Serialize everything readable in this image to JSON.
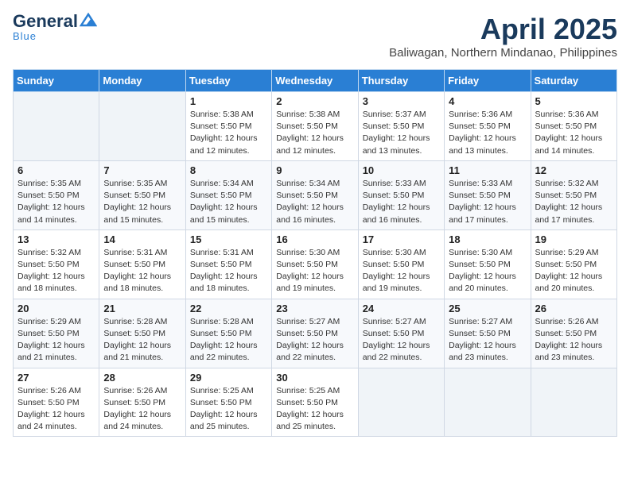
{
  "header": {
    "logo_line1": "General",
    "logo_line2": "Blue",
    "month_year": "April 2025",
    "location": "Baliwagan, Northern Mindanao, Philippines"
  },
  "weekdays": [
    "Sunday",
    "Monday",
    "Tuesday",
    "Wednesday",
    "Thursday",
    "Friday",
    "Saturday"
  ],
  "weeks": [
    [
      {
        "day": "",
        "info": ""
      },
      {
        "day": "",
        "info": ""
      },
      {
        "day": "1",
        "info": "Sunrise: 5:38 AM\nSunset: 5:50 PM\nDaylight: 12 hours and 12 minutes."
      },
      {
        "day": "2",
        "info": "Sunrise: 5:38 AM\nSunset: 5:50 PM\nDaylight: 12 hours and 12 minutes."
      },
      {
        "day": "3",
        "info": "Sunrise: 5:37 AM\nSunset: 5:50 PM\nDaylight: 12 hours and 13 minutes."
      },
      {
        "day": "4",
        "info": "Sunrise: 5:36 AM\nSunset: 5:50 PM\nDaylight: 12 hours and 13 minutes."
      },
      {
        "day": "5",
        "info": "Sunrise: 5:36 AM\nSunset: 5:50 PM\nDaylight: 12 hours and 14 minutes."
      }
    ],
    [
      {
        "day": "6",
        "info": "Sunrise: 5:35 AM\nSunset: 5:50 PM\nDaylight: 12 hours and 14 minutes."
      },
      {
        "day": "7",
        "info": "Sunrise: 5:35 AM\nSunset: 5:50 PM\nDaylight: 12 hours and 15 minutes."
      },
      {
        "day": "8",
        "info": "Sunrise: 5:34 AM\nSunset: 5:50 PM\nDaylight: 12 hours and 15 minutes."
      },
      {
        "day": "9",
        "info": "Sunrise: 5:34 AM\nSunset: 5:50 PM\nDaylight: 12 hours and 16 minutes."
      },
      {
        "day": "10",
        "info": "Sunrise: 5:33 AM\nSunset: 5:50 PM\nDaylight: 12 hours and 16 minutes."
      },
      {
        "day": "11",
        "info": "Sunrise: 5:33 AM\nSunset: 5:50 PM\nDaylight: 12 hours and 17 minutes."
      },
      {
        "day": "12",
        "info": "Sunrise: 5:32 AM\nSunset: 5:50 PM\nDaylight: 12 hours and 17 minutes."
      }
    ],
    [
      {
        "day": "13",
        "info": "Sunrise: 5:32 AM\nSunset: 5:50 PM\nDaylight: 12 hours and 18 minutes."
      },
      {
        "day": "14",
        "info": "Sunrise: 5:31 AM\nSunset: 5:50 PM\nDaylight: 12 hours and 18 minutes."
      },
      {
        "day": "15",
        "info": "Sunrise: 5:31 AM\nSunset: 5:50 PM\nDaylight: 12 hours and 18 minutes."
      },
      {
        "day": "16",
        "info": "Sunrise: 5:30 AM\nSunset: 5:50 PM\nDaylight: 12 hours and 19 minutes."
      },
      {
        "day": "17",
        "info": "Sunrise: 5:30 AM\nSunset: 5:50 PM\nDaylight: 12 hours and 19 minutes."
      },
      {
        "day": "18",
        "info": "Sunrise: 5:30 AM\nSunset: 5:50 PM\nDaylight: 12 hours and 20 minutes."
      },
      {
        "day": "19",
        "info": "Sunrise: 5:29 AM\nSunset: 5:50 PM\nDaylight: 12 hours and 20 minutes."
      }
    ],
    [
      {
        "day": "20",
        "info": "Sunrise: 5:29 AM\nSunset: 5:50 PM\nDaylight: 12 hours and 21 minutes."
      },
      {
        "day": "21",
        "info": "Sunrise: 5:28 AM\nSunset: 5:50 PM\nDaylight: 12 hours and 21 minutes."
      },
      {
        "day": "22",
        "info": "Sunrise: 5:28 AM\nSunset: 5:50 PM\nDaylight: 12 hours and 22 minutes."
      },
      {
        "day": "23",
        "info": "Sunrise: 5:27 AM\nSunset: 5:50 PM\nDaylight: 12 hours and 22 minutes."
      },
      {
        "day": "24",
        "info": "Sunrise: 5:27 AM\nSunset: 5:50 PM\nDaylight: 12 hours and 22 minutes."
      },
      {
        "day": "25",
        "info": "Sunrise: 5:27 AM\nSunset: 5:50 PM\nDaylight: 12 hours and 23 minutes."
      },
      {
        "day": "26",
        "info": "Sunrise: 5:26 AM\nSunset: 5:50 PM\nDaylight: 12 hours and 23 minutes."
      }
    ],
    [
      {
        "day": "27",
        "info": "Sunrise: 5:26 AM\nSunset: 5:50 PM\nDaylight: 12 hours and 24 minutes."
      },
      {
        "day": "28",
        "info": "Sunrise: 5:26 AM\nSunset: 5:50 PM\nDaylight: 12 hours and 24 minutes."
      },
      {
        "day": "29",
        "info": "Sunrise: 5:25 AM\nSunset: 5:50 PM\nDaylight: 12 hours and 25 minutes."
      },
      {
        "day": "30",
        "info": "Sunrise: 5:25 AM\nSunset: 5:50 PM\nDaylight: 12 hours and 25 minutes."
      },
      {
        "day": "",
        "info": ""
      },
      {
        "day": "",
        "info": ""
      },
      {
        "day": "",
        "info": ""
      }
    ]
  ]
}
